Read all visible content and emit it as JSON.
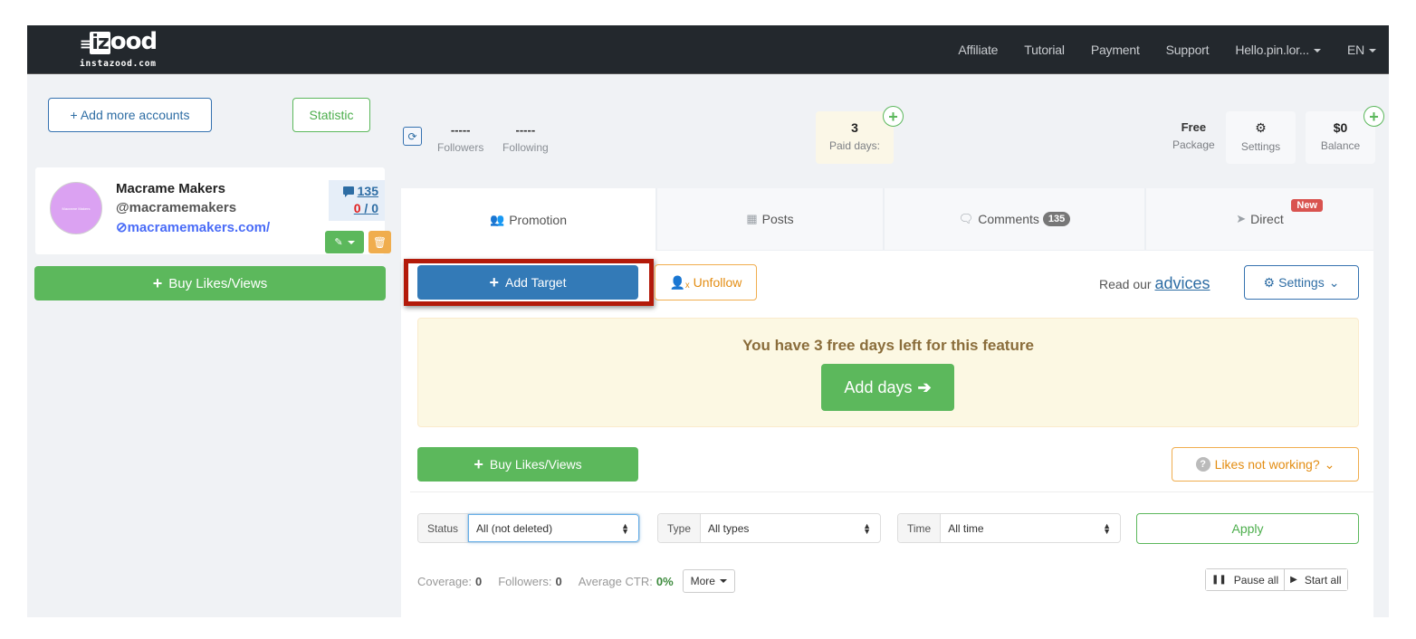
{
  "navbar": {
    "logo_text": "izood",
    "logo_domain": "instazood.com",
    "links": [
      "Affiliate",
      "Tutorial",
      "Payment",
      "Support"
    ],
    "user_menu": "Hello.pin.lor...",
    "language": "EN"
  },
  "sidebar": {
    "add_accounts_label": "+ Add more accounts",
    "statistic_label": "Statistic",
    "account": {
      "avatar_text": "Macrame Makers",
      "name": "Macrame Makers",
      "handle": "@macramemakers",
      "website": "macramemakers.com/",
      "comments_count": "135",
      "ratio_left": "0",
      "ratio_sep": " / ",
      "ratio_right": "0"
    },
    "buy_label": "Buy Likes/Views"
  },
  "stats": {
    "followers_value": "-----",
    "followers_label": "Followers",
    "following_value": "-----",
    "following_label": "Following",
    "paid_days_value": "3",
    "paid_days_label": "Paid days:",
    "package_value": "Free",
    "package_label": "Package",
    "settings_label": "Settings",
    "balance_value": "$0",
    "balance_label": "Balance"
  },
  "tabs": [
    {
      "label": "Promotion",
      "icon": "users-icon",
      "active": true
    },
    {
      "label": "Posts",
      "icon": "grid-icon"
    },
    {
      "label": "Comments",
      "icon": "comments-icon",
      "badge": "135"
    },
    {
      "label": "Direct",
      "icon": "paper-plane-icon",
      "badge_new": "New"
    }
  ],
  "promotion": {
    "add_target_label": "Add Target",
    "unfollow_label": "Unfollow",
    "read_our": "Read our",
    "advices_link": "advices",
    "settings_label": "Settings",
    "alert_message": "You have 3 free days left for this feature",
    "add_days_label": "Add days",
    "buy_label": "Buy Likes/Views",
    "likes_not_working_label": "Likes not working?",
    "filters": {
      "status_label": "Status",
      "status_value": "All (not deleted)",
      "type_label": "Type",
      "type_value": "All types",
      "time_label": "Time",
      "time_value": "All time",
      "apply_label": "Apply"
    },
    "summary": {
      "coverage_label": "Coverage:",
      "coverage_value": "0",
      "followers_label": "Followers:",
      "followers_value": "0",
      "ctr_label": "Average CTR:",
      "ctr_value": "0%",
      "more_label": "More"
    },
    "pause_all_label": "Pause all",
    "start_all_label": "Start all"
  },
  "colors": {
    "navbar_bg": "#23282d",
    "primary": "#337ab7",
    "success": "#5cb85c",
    "warning": "#f0ad4e",
    "danger": "#d9534f",
    "highlight": "#b31a0a"
  }
}
